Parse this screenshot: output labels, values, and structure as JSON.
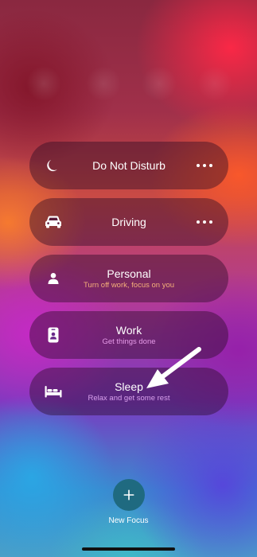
{
  "focus_modes": [
    {
      "id": "do-not-disturb",
      "title": "Do Not Disturb",
      "subtitle": "",
      "icon": "moon-icon",
      "has_more": true
    },
    {
      "id": "driving",
      "title": "Driving",
      "subtitle": "",
      "icon": "car-icon",
      "has_more": true
    },
    {
      "id": "personal",
      "title": "Personal",
      "subtitle": "Turn off work, focus on you",
      "icon": "person-icon",
      "has_more": false,
      "subtitle_color": "#f5b07a"
    },
    {
      "id": "work",
      "title": "Work",
      "subtitle": "Get things done",
      "icon": "id-badge-icon",
      "has_more": false,
      "subtitle_color": "#e59ae8"
    },
    {
      "id": "sleep",
      "title": "Sleep",
      "subtitle": "Relax and get some rest",
      "icon": "bed-icon",
      "has_more": false,
      "subtitle_color": "#d8a0ec"
    }
  ],
  "new_focus": {
    "label": "New Focus",
    "icon": "plus-icon",
    "color": "#1f6a80"
  },
  "annotation": {
    "icon": "arrow-icon",
    "points_to": "sleep"
  }
}
